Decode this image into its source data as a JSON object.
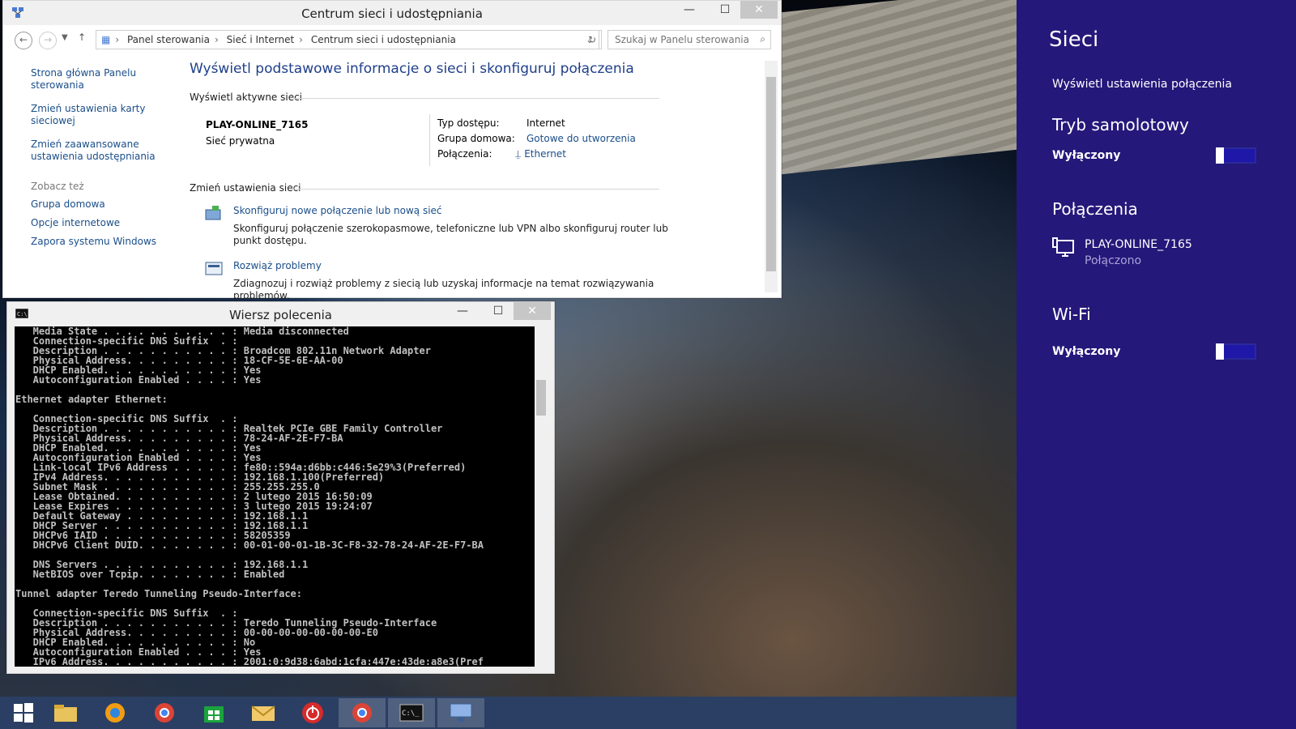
{
  "control_panel": {
    "title": "Centrum sieci i udostępniania",
    "breadcrumb": [
      "Panel sterowania",
      "Sieć i Internet",
      "Centrum sieci i udostępniania"
    ],
    "search_placeholder": "Szukaj w Panelu sterowania",
    "left_nav": {
      "home": "Strona główna Panelu sterowania",
      "adapter": "Zmień ustawienia karty sieciowej",
      "advanced": "Zmień zaawansowane ustawienia udostępniania",
      "see_also": "Zobacz też",
      "see_also_items": [
        "Grupa domowa",
        "Opcje internetowe",
        "Zapora systemu Windows"
      ]
    },
    "main_title": "Wyświetl podstawowe informacje o sieci i skonfiguruj połączenia",
    "active_networks_label": "Wyświetl aktywne sieci",
    "network_name": "PLAY-ONLINE_7165",
    "network_type": "Sieć prywatna",
    "access_type_label": "Typ dostępu:",
    "access_type_value": "Internet",
    "homegroup_label": "Grupa domowa:",
    "homegroup_value": "Gotowe do utworzenia",
    "connections_label": "Połączenia:",
    "connections_value": "Ethernet",
    "change_settings_label": "Zmień ustawienia sieci",
    "task1_title": "Skonfiguruj nowe połączenie lub nową sieć",
    "task1_desc": "Skonfiguruj połączenie szerokopasmowe, telefoniczne lub VPN albo skonfiguruj router lub punkt dostępu.",
    "task2_title": "Rozwiąż problemy",
    "task2_desc": "Zdiagnozuj i rozwiąż problemy z siecią lub uzyskaj informacje na temat rozwiązywania problemów."
  },
  "cmd": {
    "title": "Wiersz polecenia",
    "output": "   Media State . . . . . . . . . . . : Media disconnected\n   Connection-specific DNS Suffix  . :\n   Description . . . . . . . . . . . : Broadcom 802.11n Network Adapter\n   Physical Address. . . . . . . . . : 18-CF-5E-6E-AA-00\n   DHCP Enabled. . . . . . . . . . . : Yes\n   Autoconfiguration Enabled . . . . : Yes\n\nEthernet adapter Ethernet:\n\n   Connection-specific DNS Suffix  . :\n   Description . . . . . . . . . . . : Realtek PCIe GBE Family Controller\n   Physical Address. . . . . . . . . : 78-24-AF-2E-F7-BA\n   DHCP Enabled. . . . . . . . . . . : Yes\n   Autoconfiguration Enabled . . . . : Yes\n   Link-local IPv6 Address . . . . . : fe80::594a:d6bb:c446:5e29%3(Preferred)\n   IPv4 Address. . . . . . . . . . . : 192.168.1.100(Preferred)\n   Subnet Mask . . . . . . . . . . . : 255.255.255.0\n   Lease Obtained. . . . . . . . . . : 2 lutego 2015 16:50:09\n   Lease Expires . . . . . . . . . . : 3 lutego 2015 19:24:07\n   Default Gateway . . . . . . . . . : 192.168.1.1\n   DHCP Server . . . . . . . . . . . : 192.168.1.1\n   DHCPv6 IAID . . . . . . . . . . . : 58205359\n   DHCPv6 Client DUID. . . . . . . . : 00-01-00-01-1B-3C-F8-32-78-24-AF-2E-F7-BA\n\n   DNS Servers . . . . . . . . . . . : 192.168.1.1\n   NetBIOS over Tcpip. . . . . . . . : Enabled\n\nTunnel adapter Teredo Tunneling Pseudo-Interface:\n\n   Connection-specific DNS Suffix  . :\n   Description . . . . . . . . . . . : Teredo Tunneling Pseudo-Interface\n   Physical Address. . . . . . . . . : 00-00-00-00-00-00-00-E0\n   DHCP Enabled. . . . . . . . . . . : No\n   Autoconfiguration Enabled . . . . : Yes\n   IPv6 Address. . . . . . . . . . . : 2001:0:9d38:6abd:1cfa:447e:43de:a8e3(Pref"
  },
  "net_panel": {
    "title": "Sieci",
    "view_settings": "Wyświetl ustawienia połączenia",
    "airplane_label": "Tryb samolotowy",
    "airplane_state": "Wyłączony",
    "connections_label": "Połączenia",
    "conn_name": "PLAY-ONLINE_7165",
    "conn_status": "Połączono",
    "wifi_label": "Wi-Fi",
    "wifi_state": "Wyłączony"
  },
  "colors": {
    "panel_bg": "#24187a",
    "link": "#1a4e8a",
    "taskbar": "#2a3f63"
  }
}
